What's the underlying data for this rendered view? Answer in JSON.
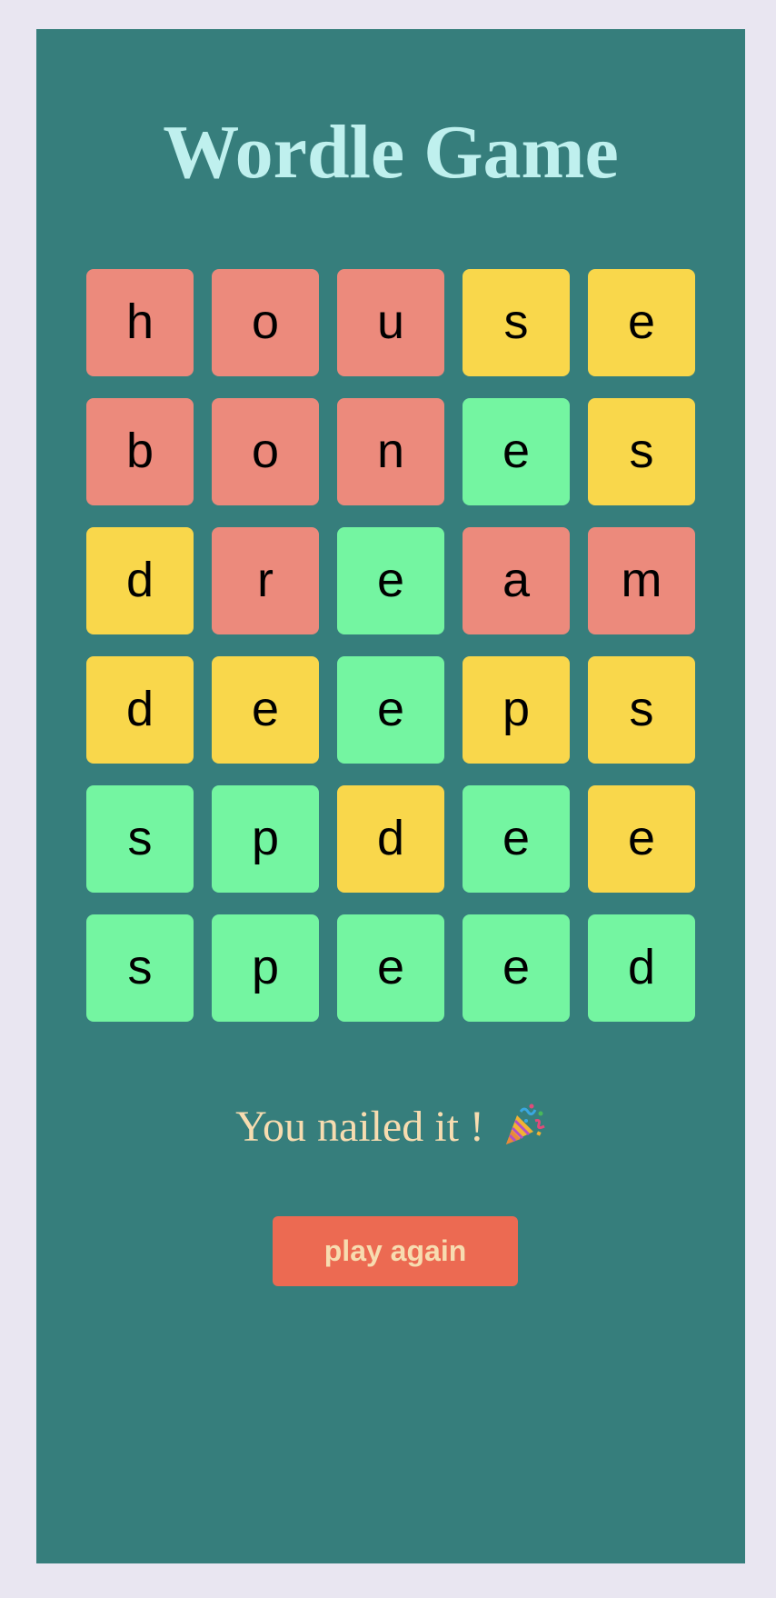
{
  "app": {
    "title": "Wordle Game"
  },
  "board": {
    "rows": [
      [
        {
          "letter": "h",
          "state": "absent"
        },
        {
          "letter": "o",
          "state": "absent"
        },
        {
          "letter": "u",
          "state": "absent"
        },
        {
          "letter": "s",
          "state": "present"
        },
        {
          "letter": "e",
          "state": "present"
        }
      ],
      [
        {
          "letter": "b",
          "state": "absent"
        },
        {
          "letter": "o",
          "state": "absent"
        },
        {
          "letter": "n",
          "state": "absent"
        },
        {
          "letter": "e",
          "state": "correct"
        },
        {
          "letter": "s",
          "state": "present"
        }
      ],
      [
        {
          "letter": "d",
          "state": "present"
        },
        {
          "letter": "r",
          "state": "absent"
        },
        {
          "letter": "e",
          "state": "correct"
        },
        {
          "letter": "a",
          "state": "absent"
        },
        {
          "letter": "m",
          "state": "absent"
        }
      ],
      [
        {
          "letter": "d",
          "state": "present"
        },
        {
          "letter": "e",
          "state": "present"
        },
        {
          "letter": "e",
          "state": "correct"
        },
        {
          "letter": "p",
          "state": "present"
        },
        {
          "letter": "s",
          "state": "present"
        }
      ],
      [
        {
          "letter": "s",
          "state": "correct"
        },
        {
          "letter": "p",
          "state": "correct"
        },
        {
          "letter": "d",
          "state": "present"
        },
        {
          "letter": "e",
          "state": "correct"
        },
        {
          "letter": "e",
          "state": "present"
        }
      ],
      [
        {
          "letter": "s",
          "state": "correct"
        },
        {
          "letter": "p",
          "state": "correct"
        },
        {
          "letter": "e",
          "state": "correct"
        },
        {
          "letter": "e",
          "state": "correct"
        },
        {
          "letter": "d",
          "state": "correct"
        }
      ]
    ]
  },
  "result": {
    "message": "You nailed it !",
    "icon": "party-popper-icon"
  },
  "controls": {
    "play_again_label": "play again"
  },
  "colors": {
    "background": "#e9e6f1",
    "panel": "#367e7c",
    "title": "#bff0ee",
    "absent": "#ec8a7c",
    "present": "#f9d74b",
    "correct": "#74f5a1",
    "message": "#f7dcb0",
    "button": "#ec6a52"
  }
}
